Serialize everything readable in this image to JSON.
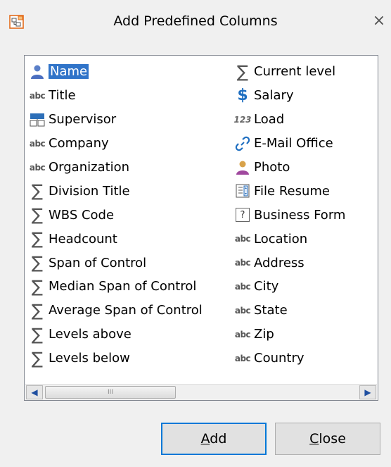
{
  "window": {
    "title": "Add Predefined Columns",
    "close_glyph": "×",
    "app_icon": "org-chart-icon"
  },
  "list": {
    "left_items": [
      {
        "label": "Name",
        "icon": "person-icon",
        "selected": true
      },
      {
        "label": "Title",
        "icon": "abc-text-icon"
      },
      {
        "label": "Supervisor",
        "icon": "supervisor-chart-icon"
      },
      {
        "label": "Company",
        "icon": "abc-text-icon"
      },
      {
        "label": "Organization",
        "icon": "abc-text-icon"
      },
      {
        "label": "Division Title",
        "icon": "sigma-icon"
      },
      {
        "label": "WBS Code",
        "icon": "sigma-icon"
      },
      {
        "label": "Headcount",
        "icon": "sigma-icon"
      },
      {
        "label": "Span of Control",
        "icon": "sigma-icon"
      },
      {
        "label": "Median Span of Control",
        "icon": "sigma-icon"
      },
      {
        "label": "Average Span of Control",
        "icon": "sigma-icon"
      },
      {
        "label": "Levels above",
        "icon": "sigma-icon"
      },
      {
        "label": "Levels below",
        "icon": "sigma-icon"
      }
    ],
    "right_items": [
      {
        "label": "Current level",
        "icon": "sigma-icon"
      },
      {
        "label": "Salary",
        "icon": "dollar-icon"
      },
      {
        "label": "Load",
        "icon": "number-123-icon"
      },
      {
        "label": "E-Mail Office",
        "icon": "link-icon"
      },
      {
        "label": "Photo",
        "icon": "photo-person-icon"
      },
      {
        "label": "File Resume",
        "icon": "file-icon"
      },
      {
        "label": "Business Form",
        "icon": "question-box-icon"
      },
      {
        "label": "Location",
        "icon": "abc-text-icon"
      },
      {
        "label": "Address",
        "icon": "abc-text-icon"
      },
      {
        "label": "City",
        "icon": "abc-text-icon"
      },
      {
        "label": "State",
        "icon": "abc-text-icon"
      },
      {
        "label": "Zip",
        "icon": "abc-text-icon"
      },
      {
        "label": "Country",
        "icon": "abc-text-icon"
      }
    ],
    "icon_glyphs": {
      "abc": "abc",
      "sigma": "∑",
      "dollar": "$",
      "num": "123",
      "link": "✂",
      "question": "?"
    },
    "selection_color": "#3074c9"
  },
  "buttons": {
    "add_label": "Add",
    "add_accel": "A",
    "add_rest": "dd",
    "close_label": "Close",
    "close_accel": "C",
    "close_rest": "lose"
  },
  "scrollbar": {
    "left_arrow": "◀",
    "right_arrow": "▶",
    "grip": "III"
  }
}
